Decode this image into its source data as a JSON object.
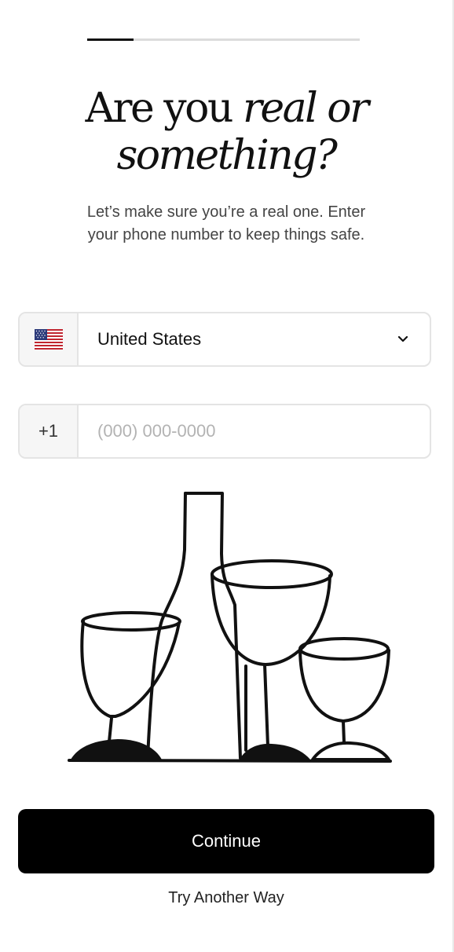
{
  "progress": {
    "value": 0.17
  },
  "heading": {
    "part1": "Are you ",
    "part2_italic": "real or",
    "part3_italic": "something?"
  },
  "subtitle": "Let’s make sure you’re a real one. Enter your phone number to keep things safe.",
  "country_select": {
    "flag_icon": "us-flag-icon",
    "selected": "United States",
    "dropdown_icon": "chevron-down-icon"
  },
  "phone": {
    "dial_code": "+1",
    "placeholder": "(000) 000-0000",
    "value": ""
  },
  "illustration_icon": "wine-bottle-and-glasses-illustration",
  "buttons": {
    "continue": "Continue",
    "try_another": "Try Another Way"
  },
  "colors": {
    "primary_button": "#000000",
    "progress_track": "#dcdcdc",
    "progress_fill": "#111111"
  }
}
